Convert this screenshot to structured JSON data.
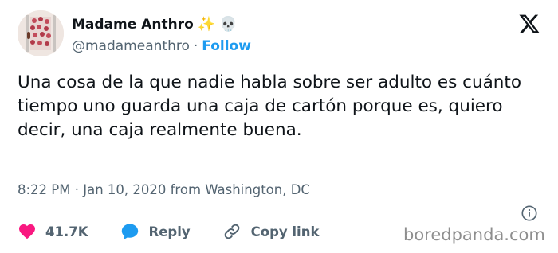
{
  "author": {
    "display_name": "Madame Anthro",
    "emoji": [
      "✨",
      "💀"
    ],
    "handle": "@madameanthro",
    "separator": "·",
    "follow_label": "Follow"
  },
  "tweet": {
    "text": "Una cosa de la que nadie habla sobre ser adulto es cuánto tiempo uno guarda una caja de cartón porque es, quiero decir, una caja realmente buena."
  },
  "meta": {
    "timestamp": "8:22 PM · Jan 10, 2020 from Washington, DC"
  },
  "actions": {
    "like_count": "41.7K",
    "reply_label": "Reply",
    "copy_link_label": "Copy link"
  },
  "watermark": "boredpanda.com",
  "colors": {
    "accent": "#1d9bf0",
    "like": "#f91880",
    "text": "#0f1419",
    "muted": "#536471"
  },
  "icons": {
    "brand": "x-logo-icon",
    "info": "info-icon",
    "like": "heart-icon",
    "reply": "speech-bubble-icon",
    "copy_link": "link-icon"
  }
}
